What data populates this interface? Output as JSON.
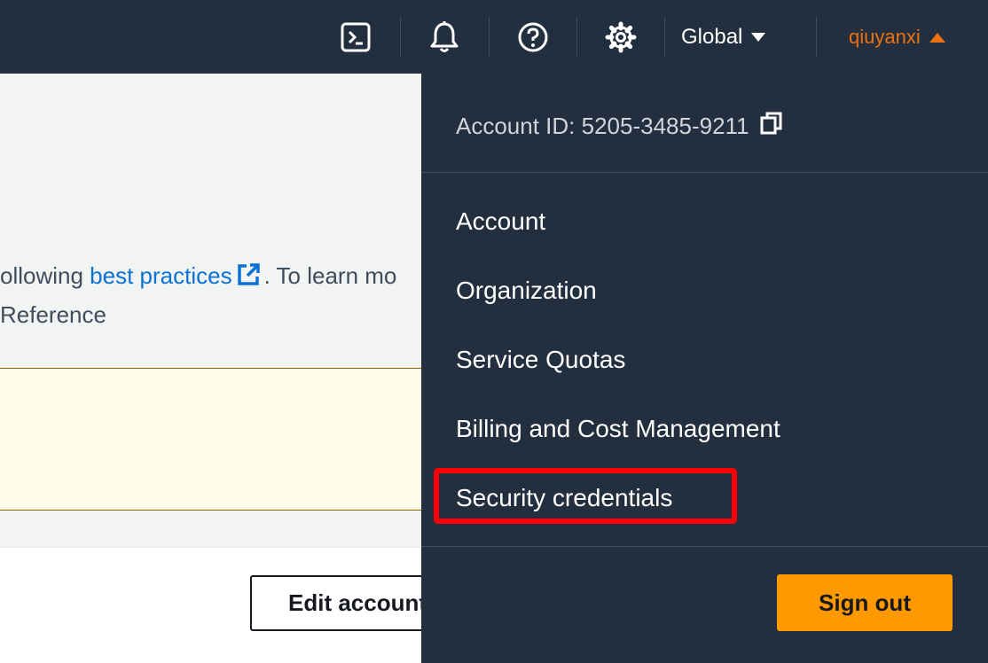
{
  "topbar": {
    "icons": [
      "cloudshell-icon",
      "bell-icon",
      "help-icon",
      "gear-icon"
    ],
    "region_label": "Global",
    "username": "qiuyanxi",
    "colors": {
      "background": "#232f3e",
      "username": "#ec7211"
    }
  },
  "page": {
    "line1_prefix": "ollowing ",
    "line1_link": "best practices",
    "line1_suffix": ". To learn mo",
    "line2": "Reference",
    "edit_button_label": "Edit account"
  },
  "dropdown": {
    "account_id_label": "Account ID: 5205-3485-9211",
    "items": [
      {
        "label": "Account"
      },
      {
        "label": "Organization"
      },
      {
        "label": "Service Quotas"
      },
      {
        "label": "Billing and Cost Management"
      },
      {
        "label": "Security credentials",
        "highlighted": true
      }
    ],
    "sign_out_label": "Sign out",
    "colors": {
      "sign_out": "#ff9900",
      "highlight": "#ff0000"
    }
  }
}
